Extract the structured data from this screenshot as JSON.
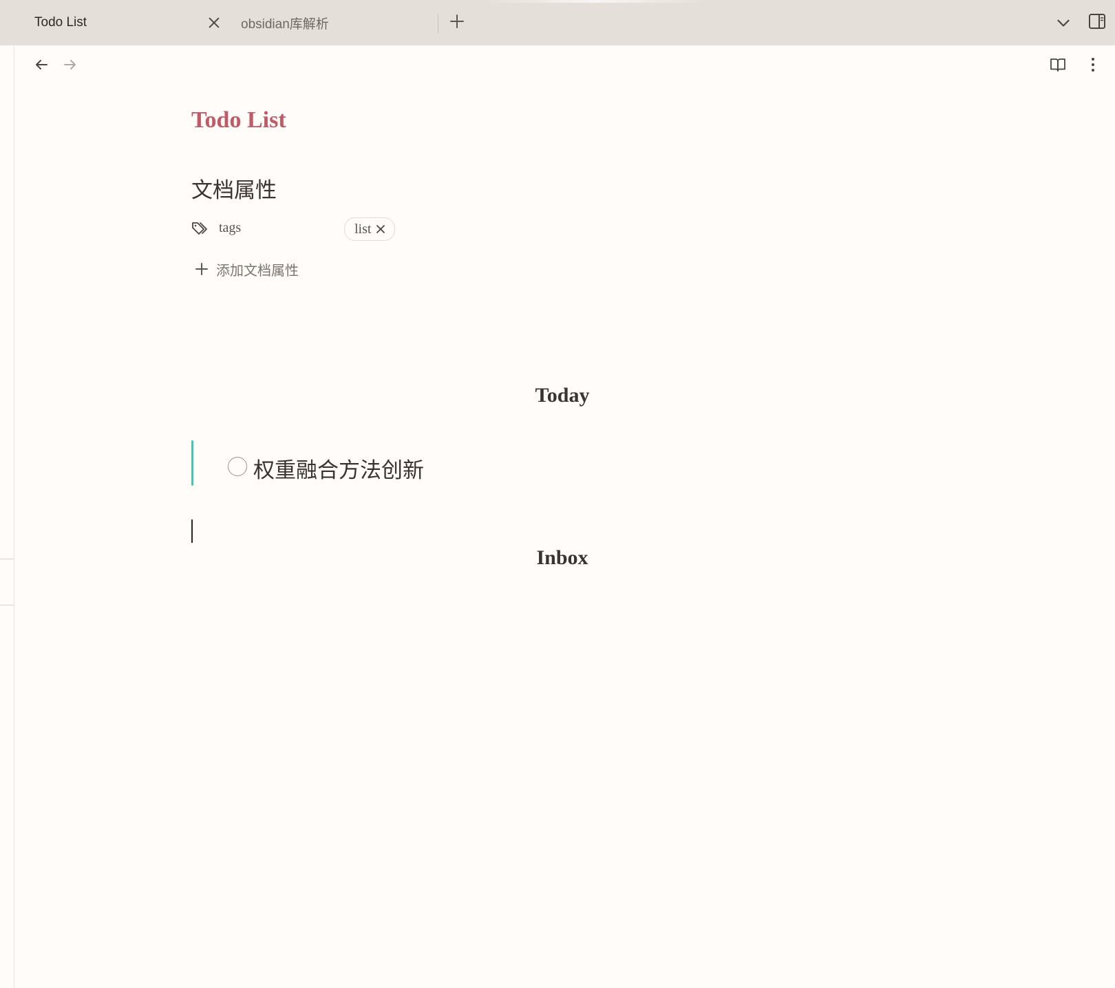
{
  "tabs": [
    {
      "label": "Todo List",
      "active": true
    },
    {
      "label": "obsidian库解析",
      "active": false
    }
  ],
  "icons": {
    "tab_close": "close-icon",
    "new_tab": "plus-icon",
    "tab_list": "chevron-down-icon",
    "sidebar_toggle": "sidebar-right-icon",
    "back": "arrow-left-icon",
    "forward": "arrow-right-icon",
    "reading_view": "book-open-icon",
    "more_options": "more-vertical-icon",
    "property": "tags-icon",
    "add_property": "plus-icon",
    "remove_tag": "close-icon"
  },
  "document": {
    "title": "Todo List",
    "properties_heading": "文档属性",
    "properties": [
      {
        "key": "tags",
        "values": [
          "list"
        ]
      }
    ],
    "add_property_label": "添加文档属性",
    "sections": [
      {
        "heading": "Today",
        "tasks": [
          {
            "text": "权重融合方法创新",
            "done": false
          }
        ]
      },
      {
        "heading": "Inbox",
        "tasks": []
      }
    ]
  },
  "colors": {
    "title": "#c15a67",
    "callout_accent": "#3ec8b7",
    "tabbar_bg": "#e4dfd9",
    "page_bg": "#fffcf9"
  }
}
